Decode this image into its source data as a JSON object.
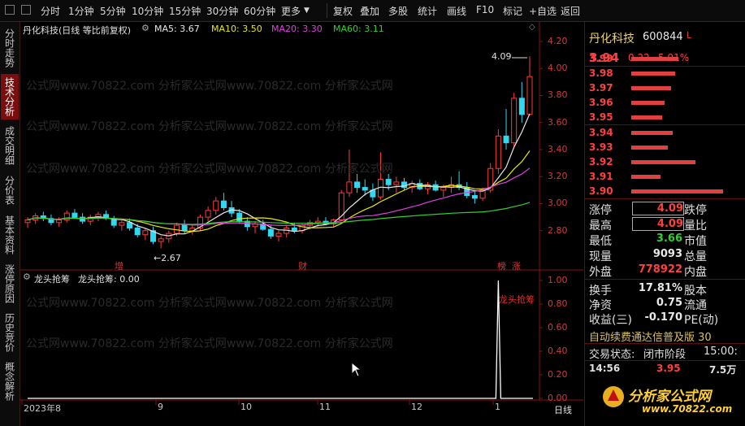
{
  "toolbar": {
    "periods": [
      "分时",
      "1分钟",
      "5分钟",
      "10分钟",
      "15分钟",
      "30分钟",
      "60分钟",
      "更多"
    ],
    "right_items": [
      "复权",
      "叠加",
      "多股",
      "统计",
      "画线",
      "F10",
      "标记",
      "+自选",
      "返回"
    ]
  },
  "sidetabs": [
    "分时走势",
    "技术分析",
    "成交明细",
    "分价表",
    "基本资料",
    "涨停原因",
    "历史竞价",
    "概念解析"
  ],
  "main_chart": {
    "title": "丹化科技(日线 等比前复权)",
    "ma": [
      {
        "label": "MA5: 3.67",
        "color": "#e8e8e8"
      },
      {
        "label": "MA10: 3.50",
        "color": "#e8e800"
      },
      {
        "label": "MA20: 3.30",
        "color": "#e040e0"
      },
      {
        "label": "MA60: 3.11",
        "color": "#30d030"
      }
    ],
    "y_ticks": [
      "4.20",
      "4.00",
      "3.80",
      "3.60",
      "3.40",
      "3.20",
      "3.00",
      "2.80"
    ],
    "high_label": "4.09",
    "low_label": "2.67",
    "markers": [
      "增",
      "财",
      "榜",
      "涨"
    ]
  },
  "indicator": {
    "title": "龙头抢筹",
    "value_label": "龙头抢筹: 0.00",
    "signal_label": "龙头抢筹",
    "y_ticks": [
      "1.00",
      "0.80",
      "0.60",
      "0.40",
      "0.20",
      "0.00"
    ]
  },
  "dates": [
    "2023年8",
    "9",
    "10",
    "11",
    "12",
    "1"
  ],
  "period_label": "日线",
  "watermark": "公式网www.70822.com 分析家公式网www.70822.com 分析家公式网",
  "quote": {
    "name": "丹化科技",
    "code": "600844",
    "code_suffix": "L",
    "price": "3.94",
    "change": "0.22",
    "pct": "5.91%",
    "asks": [
      {
        "price": "3.99",
        "vol": 0.45
      },
      {
        "price": "3.98",
        "vol": 0.42
      },
      {
        "price": "3.97",
        "vol": 0.38
      },
      {
        "price": "3.96",
        "vol": 0.32
      },
      {
        "price": "3.95",
        "vol": 0.3
      }
    ],
    "bids": [
      {
        "price": "3.94",
        "vol": 0.4
      },
      {
        "price": "3.93",
        "vol": 0.35
      },
      {
        "price": "3.92",
        "vol": 0.62
      },
      {
        "price": "3.91",
        "vol": 0.28
      },
      {
        "price": "3.90",
        "vol": 0.88
      }
    ],
    "stats": [
      {
        "k1": "涨停",
        "v1": "4.09",
        "c1": "#ff4040",
        "boxed": true,
        "k2": "跌停"
      },
      {
        "k1": "最高",
        "v1": "4.09",
        "c1": "#ff4040",
        "boxed": true,
        "k2": "量比"
      },
      {
        "k1": "最低",
        "v1": "3.66",
        "c1": "#30d030",
        "boxed": false,
        "k2": "市值"
      },
      {
        "k1": "现量",
        "v1": "9093",
        "c1": "#e8e8e8",
        "boxed": false,
        "k2": "总量"
      },
      {
        "k1": "外盘",
        "v1": "778922",
        "c1": "#ff4040",
        "boxed": false,
        "k2": "内盘"
      }
    ],
    "stats2": [
      {
        "k1": "换手",
        "v1": "17.81%",
        "k2": "股本"
      },
      {
        "k1": "净资",
        "v1": "0.75",
        "k2": "流通"
      },
      {
        "k1": "收益(三)",
        "v1": "-0.170",
        "k2": "PE(动)"
      }
    ],
    "ad_text": "自动续费通达信普及版 30",
    "trade_status_label": "交易状态:",
    "trade_status": "闭市阶段",
    "trade_time": "15:00:",
    "tick_time": "14:56",
    "tick_price": "3.95",
    "tick_vol": "7.5万",
    "logo_text": "分析家公式网",
    "logo_url": "www.70822.com"
  },
  "chart_data": {
    "type": "candlestick",
    "ylim": [
      2.6,
      4.26
    ],
    "candles": [
      [
        2.86,
        2.9,
        2.82,
        2.88
      ],
      [
        2.88,
        2.93,
        2.85,
        2.91
      ],
      [
        2.91,
        2.94,
        2.87,
        2.89
      ],
      [
        2.89,
        2.92,
        2.84,
        2.86
      ],
      [
        2.86,
        2.9,
        2.83,
        2.88
      ],
      [
        2.88,
        2.95,
        2.86,
        2.93
      ],
      [
        2.93,
        2.96,
        2.89,
        2.9
      ],
      [
        2.9,
        2.93,
        2.85,
        2.87
      ],
      [
        2.87,
        2.92,
        2.84,
        2.9
      ],
      [
        2.9,
        2.94,
        2.87,
        2.92
      ],
      [
        2.92,
        2.95,
        2.88,
        2.89
      ],
      [
        2.89,
        2.91,
        2.82,
        2.84
      ],
      [
        2.84,
        2.88,
        2.8,
        2.86
      ],
      [
        2.86,
        2.89,
        2.8,
        2.82
      ],
      [
        2.82,
        2.85,
        2.75,
        2.77
      ],
      [
        2.77,
        2.82,
        2.73,
        2.8
      ],
      [
        2.8,
        2.83,
        2.7,
        2.72
      ],
      [
        2.72,
        2.76,
        2.67,
        2.74
      ],
      [
        2.74,
        2.8,
        2.71,
        2.78
      ],
      [
        2.78,
        2.86,
        2.76,
        2.84
      ],
      [
        2.84,
        2.88,
        2.78,
        2.8
      ],
      [
        2.8,
        2.84,
        2.77,
        2.82
      ],
      [
        2.82,
        2.92,
        2.8,
        2.9
      ],
      [
        2.9,
        2.98,
        2.87,
        2.95
      ],
      [
        2.95,
        3.05,
        2.92,
        3.02
      ],
      [
        3.02,
        3.08,
        2.95,
        2.97
      ],
      [
        2.97,
        3.02,
        2.9,
        2.93
      ],
      [
        2.93,
        2.96,
        2.85,
        2.87
      ],
      [
        2.87,
        2.9,
        2.8,
        2.83
      ],
      [
        2.83,
        2.87,
        2.78,
        2.85
      ],
      [
        2.85,
        2.88,
        2.8,
        2.81
      ],
      [
        2.81,
        2.84,
        2.74,
        2.76
      ],
      [
        2.76,
        2.8,
        2.72,
        2.78
      ],
      [
        2.78,
        2.84,
        2.75,
        2.82
      ],
      [
        2.82,
        2.86,
        2.78,
        2.8
      ],
      [
        2.8,
        2.85,
        2.78,
        2.84
      ],
      [
        2.84,
        2.88,
        2.81,
        2.86
      ],
      [
        2.86,
        2.9,
        2.83,
        2.87
      ],
      [
        2.87,
        2.9,
        2.84,
        2.85
      ],
      [
        2.85,
        2.89,
        2.83,
        2.88
      ],
      [
        2.88,
        3.1,
        2.87,
        3.08
      ],
      [
        3.08,
        3.4,
        3.05,
        3.16
      ],
      [
        3.16,
        3.22,
        3.08,
        3.12
      ],
      [
        3.12,
        3.18,
        3.06,
        3.1
      ],
      [
        3.1,
        3.15,
        3.02,
        3.05
      ],
      [
        3.05,
        3.38,
        3.03,
        3.18
      ],
      [
        3.18,
        3.22,
        3.1,
        3.14
      ],
      [
        3.14,
        3.2,
        3.08,
        3.16
      ],
      [
        3.16,
        3.19,
        3.1,
        3.12
      ],
      [
        3.12,
        3.17,
        3.08,
        3.15
      ],
      [
        3.15,
        3.18,
        3.1,
        3.11
      ],
      [
        3.11,
        3.16,
        3.07,
        3.14
      ],
      [
        3.14,
        3.17,
        3.09,
        3.1
      ],
      [
        3.1,
        3.14,
        3.05,
        3.12
      ],
      [
        3.12,
        3.2,
        3.08,
        3.14
      ],
      [
        3.14,
        3.24,
        3.1,
        3.12
      ],
      [
        3.12,
        3.16,
        3.04,
        3.06
      ],
      [
        3.06,
        3.1,
        3.0,
        3.04
      ],
      [
        3.04,
        3.12,
        3.02,
        3.1
      ],
      [
        3.1,
        3.3,
        3.08,
        3.26
      ],
      [
        3.26,
        3.55,
        3.22,
        3.5
      ],
      [
        3.5,
        3.7,
        3.4,
        3.45
      ],
      [
        3.45,
        3.82,
        3.42,
        3.78
      ],
      [
        3.78,
        3.9,
        3.6,
        3.66
      ],
      [
        3.66,
        4.09,
        3.65,
        3.94
      ]
    ]
  }
}
